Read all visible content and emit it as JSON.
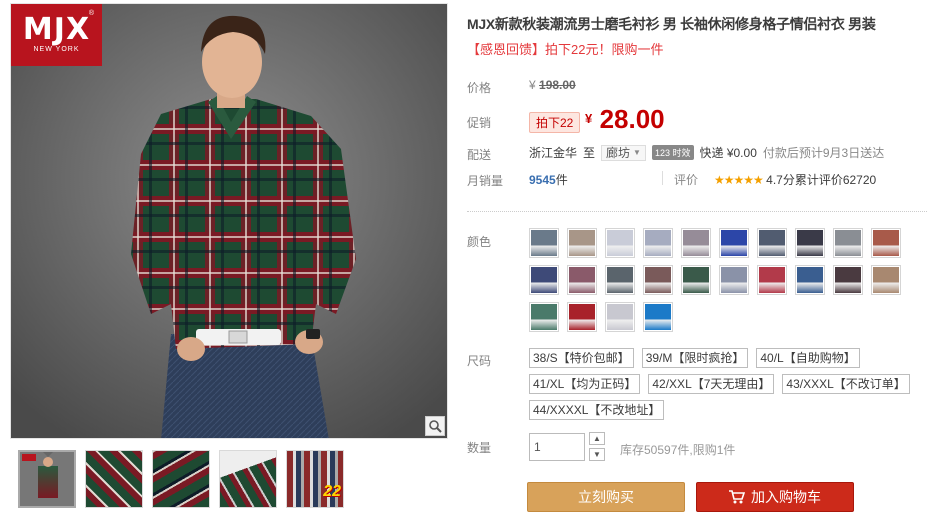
{
  "brand": {
    "logo_text": "MJX",
    "logo_sub": "NEW YORK",
    "logo_reg": "®"
  },
  "product": {
    "title": "MJX新款秋装潮流男士磨毛衬衫 男 长袖休闲修身格子情侣衬衣 男装",
    "subtitle": "【感恩回馈】拍下22元！限购一件"
  },
  "price": {
    "label": "价格",
    "currency": "¥",
    "original": "198.00"
  },
  "promo": {
    "label": "促销",
    "tag": "拍下22",
    "currency": "¥",
    "price": "28.00"
  },
  "shipping": {
    "label": "配送",
    "from": "浙江金华",
    "to_word": "至",
    "city": "廊坊",
    "badge": "123 时效",
    "method": "快递 ¥0.00",
    "note": "付款后预计9月3日送达"
  },
  "sales": {
    "label": "月销量",
    "count": "9545",
    "unit": "件",
    "review_label": "评价",
    "stars": "★★★★★",
    "score": "4.7分",
    "review_text": "累计评价62720"
  },
  "colors": {
    "label": "颜色",
    "swatches": [
      "#6a7a8a",
      "#a89688",
      "#c9ccd8",
      "#a6acc0",
      "#968c98",
      "#2c46a8",
      "#515c70",
      "#3a3a48",
      "#8a8e94",
      "#a85a4a",
      "#3e4a78",
      "#8a5a6a",
      "#5a646c",
      "#7a5a5a",
      "#3a5a4a",
      "#8a92a8",
      "#b23a4a",
      "#3a5e90",
      "#4a3a40",
      "#a88870",
      "#4a7a6a",
      "#a8222a",
      "#c8c8d0",
      "#1c7ac8"
    ]
  },
  "sizes": {
    "label": "尺码",
    "options": [
      "38/S【特价包邮】",
      "39/M【限时疯抢】",
      "40/L【自助购物】",
      "41/XL【均为正码】",
      "42/XXL【7天无理由】",
      "43/XXXL【不改订单】",
      "44/XXXXL【不改地址】"
    ]
  },
  "quantity": {
    "label": "数量",
    "value": "1",
    "stock": "库存50597件,限购1件"
  },
  "actions": {
    "buy_now": "立刻购买",
    "add_cart": "加入购物车"
  },
  "thumbs": {
    "badge": "22"
  }
}
